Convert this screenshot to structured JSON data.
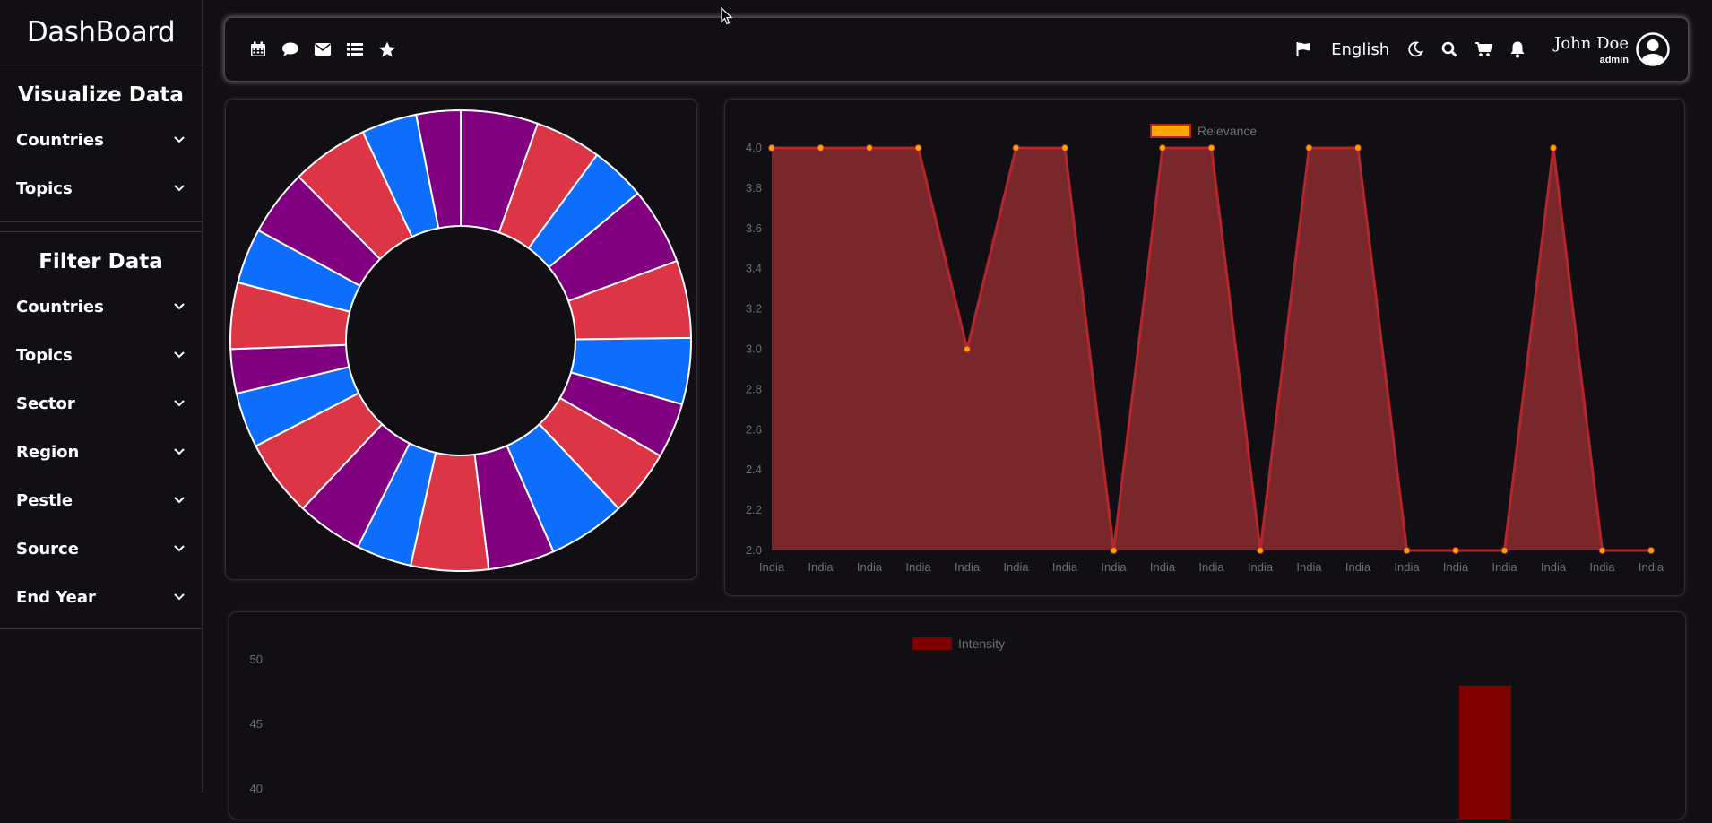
{
  "sidebar": {
    "brand": "DashBoard",
    "visualize": {
      "title": "Visualize Data",
      "items": [
        {
          "label": "Countries"
        },
        {
          "label": "Topics"
        }
      ]
    },
    "filter": {
      "title": "Filter Data",
      "items": [
        {
          "label": "Countries"
        },
        {
          "label": "Topics"
        },
        {
          "label": "Sector"
        },
        {
          "label": "Region"
        },
        {
          "label": "Pestle"
        },
        {
          "label": "Source"
        },
        {
          "label": "End Year"
        }
      ]
    }
  },
  "topbar": {
    "left_icons": [
      "calendar-icon",
      "comment-icon",
      "envelope-icon",
      "list-icon",
      "star-icon"
    ],
    "language": "English",
    "right_icons": [
      "flag-icon",
      "moon-icon",
      "search-icon",
      "cart-icon",
      "bell-icon"
    ],
    "user": {
      "name": "John Doe",
      "role": "admin"
    }
  },
  "colors": {
    "background": "#120f14",
    "donut": [
      "#800080",
      "#dc3545",
      "#0d6efd"
    ],
    "line_fill": "#7a272c",
    "line_stroke": "#b3262d",
    "point": "#ffa500",
    "bar": "#800000"
  },
  "chart_data": [
    {
      "type": "pie",
      "variant": "doughnut",
      "slice_colors": [
        "#800080",
        "#dc3545",
        "#0d6efd",
        "#800080",
        "#dc3545",
        "#0d6efd",
        "#800080",
        "#dc3545",
        "#0d6efd",
        "#800080",
        "#dc3545",
        "#0d6efd",
        "#800080",
        "#dc3545",
        "#0d6efd",
        "#800080",
        "#dc3545",
        "#0d6efd",
        "#800080",
        "#dc3545",
        "#0d6efd",
        "#800080"
      ],
      "values": [
        7,
        6,
        5,
        7,
        7,
        6,
        5,
        6,
        7,
        6,
        7,
        5,
        6,
        7,
        5,
        4,
        6,
        5,
        6,
        7,
        5,
        4
      ]
    },
    {
      "type": "area",
      "legend": "Relevance",
      "categories": [
        "India",
        "India",
        "India",
        "India",
        "India",
        "India",
        "India",
        "India",
        "India",
        "India",
        "India",
        "India",
        "India",
        "India",
        "India",
        "India",
        "India",
        "India",
        "India"
      ],
      "values": [
        4,
        4,
        4,
        4,
        3,
        4,
        4,
        2,
        4,
        4,
        2,
        4,
        4,
        2,
        2,
        2,
        4,
        2,
        2
      ],
      "ylim": [
        2.0,
        4.0
      ],
      "yticks": [
        "2.0",
        "2.2",
        "2.4",
        "2.6",
        "2.8",
        "3.0",
        "3.2",
        "3.4",
        "3.6",
        "3.8",
        "4.0"
      ]
    },
    {
      "type": "bar",
      "legend": "Intensity",
      "yticks_visible": [
        "50",
        "45",
        "40"
      ],
      "ylim_visible": [
        40,
        50
      ],
      "visible_bar_value": 48
    }
  ]
}
